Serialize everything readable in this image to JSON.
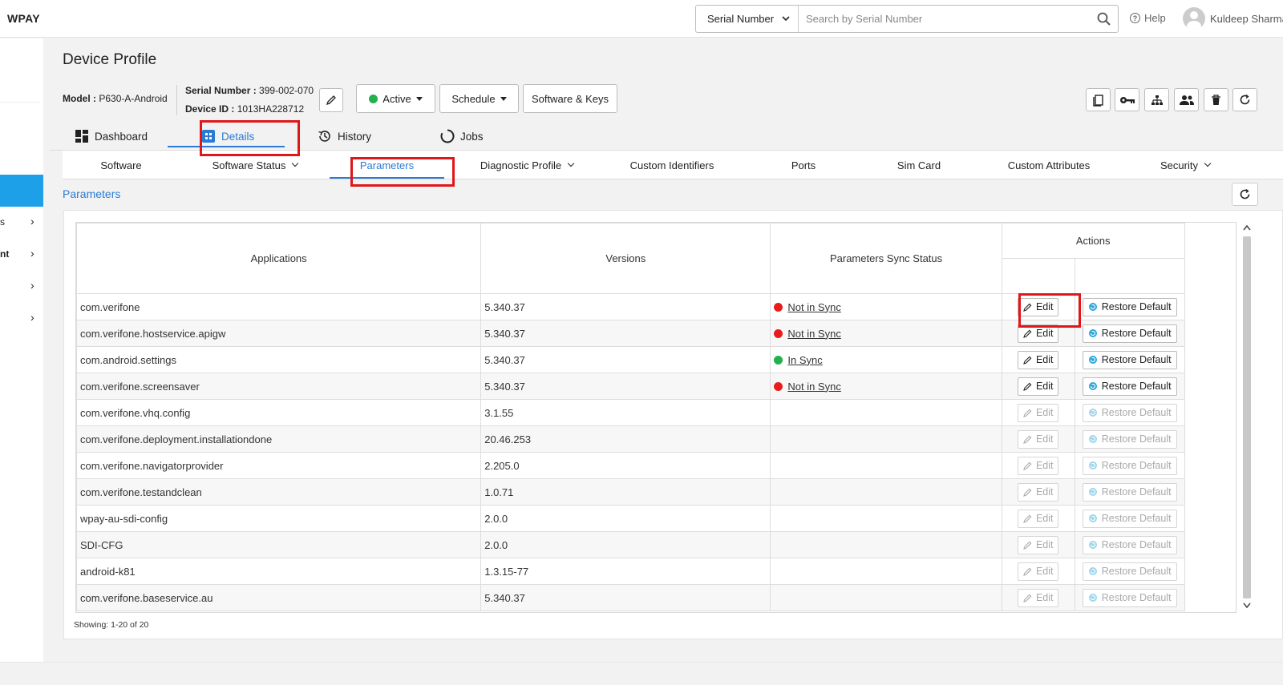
{
  "app": {
    "brand": "WPAY"
  },
  "search": {
    "type_label": "Serial Number",
    "placeholder": "Search by Serial Number"
  },
  "header": {
    "help_label": "Help",
    "user_name": "Kuldeep Sharma"
  },
  "sidebar": {
    "items": [
      {
        "label": "s"
      },
      {
        "label": "nt"
      },
      {
        "label": ""
      },
      {
        "label": ""
      }
    ]
  },
  "page": {
    "title": "Device Profile"
  },
  "device": {
    "model_label": "Model :",
    "model_value": "P630-A-Android",
    "serial_label": "Serial Number :",
    "serial_value": "399-002-070",
    "device_id_label": "Device ID :",
    "device_id_value": "1013HA228712"
  },
  "toolbar": {
    "status_label": "Active",
    "status_color": "#22b14c",
    "schedule_label": "Schedule",
    "software_keys_label": "Software & Keys"
  },
  "tabs": [
    {
      "label": "Dashboard",
      "icon": "dashboard-icon"
    },
    {
      "label": "Details",
      "icon": "details-icon"
    },
    {
      "label": "History",
      "icon": "history-icon"
    },
    {
      "label": "Jobs",
      "icon": "jobs-icon"
    }
  ],
  "subtabs": [
    {
      "label": "Software"
    },
    {
      "label": "Software Status"
    },
    {
      "label": "Parameters"
    },
    {
      "label": "Diagnostic Profile"
    },
    {
      "label": "Custom Identifiers"
    },
    {
      "label": "Ports"
    },
    {
      "label": "Sim Card"
    },
    {
      "label": "Custom Attributes"
    },
    {
      "label": "Security"
    }
  ],
  "breadcrumb": "Parameters",
  "table": {
    "headers": {
      "applications": "Applications",
      "versions": "Versions",
      "sync": "Parameters Sync Status",
      "actions": "Actions"
    },
    "edit_label": "Edit",
    "restore_label": "Restore Default",
    "rows": [
      {
        "app": "com.verifone",
        "version": "5.340.37",
        "sync": "Not in Sync",
        "sync_color": "#e81c1c"
      },
      {
        "app": "com.verifone.hostservice.apigw",
        "version": "5.340.37",
        "sync": "Not in Sync",
        "sync_color": "#e81c1c"
      },
      {
        "app": "com.android.settings",
        "version": "5.340.37",
        "sync": "In Sync",
        "sync_color": "#22b14c"
      },
      {
        "app": "com.verifone.screensaver",
        "version": "5.340.37",
        "sync": "Not in Sync",
        "sync_color": "#e81c1c"
      },
      {
        "app": "com.verifone.vhq.config",
        "version": "3.1.55",
        "sync": "",
        "sync_color": ""
      },
      {
        "app": "com.verifone.deployment.installationdone",
        "version": "20.46.253",
        "sync": "",
        "sync_color": ""
      },
      {
        "app": "com.verifone.navigatorprovider",
        "version": "2.205.0",
        "sync": "",
        "sync_color": ""
      },
      {
        "app": "com.verifone.testandclean",
        "version": "1.0.71",
        "sync": "",
        "sync_color": ""
      },
      {
        "app": "wpay-au-sdi-config",
        "version": "2.0.0",
        "sync": "",
        "sync_color": ""
      },
      {
        "app": "SDI-CFG",
        "version": "2.0.0",
        "sync": "",
        "sync_color": ""
      },
      {
        "app": "android-k81",
        "version": "1.3.15-77",
        "sync": "",
        "sync_color": ""
      },
      {
        "app": "com.verifone.baseservice.au",
        "version": "5.340.37",
        "sync": "",
        "sync_color": ""
      }
    ]
  },
  "pagination": {
    "showing": "Showing: 1-20 of 20"
  },
  "highlight_color": "#e0161b"
}
